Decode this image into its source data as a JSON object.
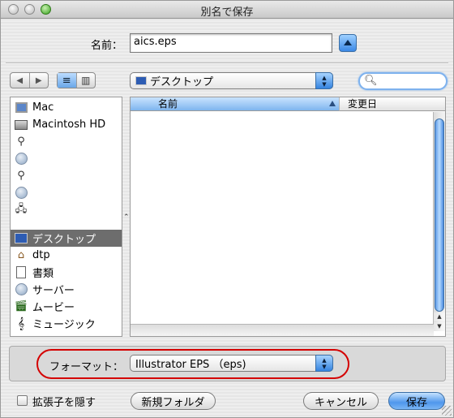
{
  "window": {
    "title": "別名で保存"
  },
  "save_as": {
    "label": "名前：",
    "value": "aics.eps"
  },
  "toolbar": {
    "nav_back_glyph": "◀",
    "nav_forward_glyph": "▶",
    "view_list_glyph": "≡",
    "view_column_glyph": "▥",
    "location": "デスクトップ",
    "search_placeholder": ""
  },
  "sidebar": {
    "items": [
      {
        "label": "Mac",
        "icon": "computer-icon"
      },
      {
        "label": "Macintosh HD",
        "icon": "hard-disk-icon"
      },
      {
        "label": "",
        "icon": "network-volume-icon"
      },
      {
        "label": "",
        "icon": "globe-icon"
      },
      {
        "label": "",
        "icon": "network-volume-icon"
      },
      {
        "label": "",
        "icon": "globe-icon"
      },
      {
        "label": "",
        "icon": "network-server-icon"
      },
      {
        "label": "デスクトップ",
        "icon": "desktop-icon",
        "selected": true
      },
      {
        "label": "dtp",
        "icon": "home-icon"
      },
      {
        "label": "書類",
        "icon": "document-icon"
      },
      {
        "label": "サーバー",
        "icon": "server-icon"
      },
      {
        "label": "ムービー",
        "icon": "movie-icon"
      },
      {
        "label": "ミュージック",
        "icon": "music-icon"
      }
    ]
  },
  "file_list": {
    "columns": [
      {
        "label": "名前",
        "sorted": true
      },
      {
        "label": "変更日",
        "sorted": false
      }
    ],
    "rows": []
  },
  "format": {
    "label": "フォーマット：",
    "value": "Illustrator EPS （eps)"
  },
  "footer": {
    "hide_extension_label": "拡張子を隠す",
    "new_folder_label": "新規フォルダ",
    "cancel_label": "キャンセル",
    "save_label": "保存"
  },
  "colors": {
    "accent": "#3b88e6",
    "highlight_oval": "#d40000",
    "selected_row": "#6d6d6d"
  }
}
